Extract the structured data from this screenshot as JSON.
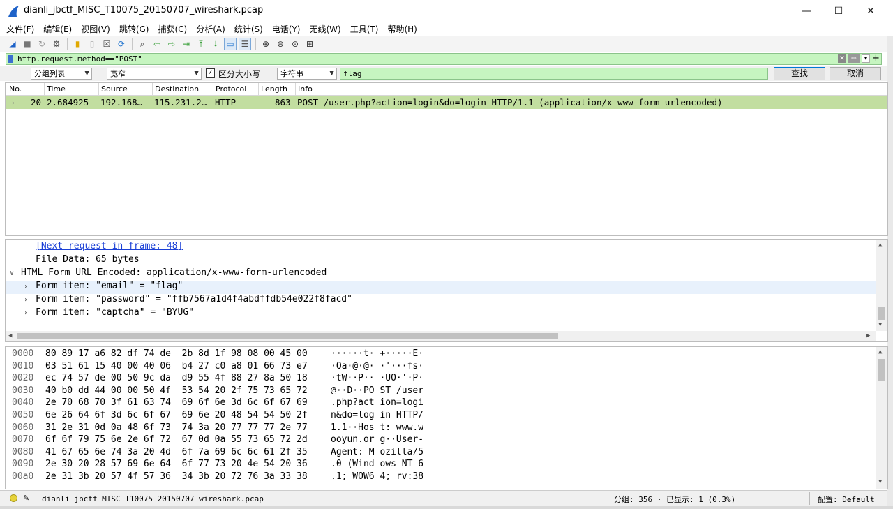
{
  "window": {
    "title": "dianli_jbctf_MISC_T10075_20150707_wireshark.pcap",
    "minimize": "—",
    "maximize": "☐",
    "close": "✕"
  },
  "menu": [
    "文件(F)",
    "编辑(E)",
    "视图(V)",
    "跳转(G)",
    "捕获(C)",
    "分析(A)",
    "统计(S)",
    "电话(Y)",
    "无线(W)",
    "工具(T)",
    "帮助(H)"
  ],
  "toolbar": {
    "icons": [
      "shark-fin-icon",
      "stop-icon",
      "restart-icon",
      "options-gear-icon",
      "open-file-icon",
      "file-icon",
      "close-file-icon",
      "reload-icon",
      "find-icon",
      "back-arrow-icon",
      "forward-arrow-icon",
      "go-to-packet-icon",
      "first-packet-icon",
      "last-packet-icon",
      "autoscroll-icon",
      "colorize-icon",
      "zoom-in-icon",
      "zoom-out-icon",
      "normal-size-icon",
      "resize-columns-icon"
    ],
    "glyphs": [
      "◢",
      "■",
      "↻",
      "⚙",
      "▮",
      "▯",
      "☒",
      "⟳",
      "⌕",
      "⇦",
      "⇨",
      "⇥",
      "⤒",
      "⤓",
      "▭",
      "☰",
      "⊕",
      "⊖",
      "⊙",
      "⊞"
    ]
  },
  "filter": {
    "value": "http.request.method==\"POST\"",
    "plus": "+",
    "clear": "✕",
    "apply": "⇨",
    "dropdown": "▾"
  },
  "find": {
    "search_in": "分组列表",
    "char_width": "宽窄",
    "case_sensitive_label": "区分大小写",
    "case_checked": "✓",
    "search_type": "字符串",
    "query": "flag",
    "find_button": "查找",
    "cancel_button": "取消"
  },
  "packet_list": {
    "columns": [
      "No.",
      "Time",
      "Source",
      "Destination",
      "Protocol",
      "Length",
      "Info"
    ],
    "rows": [
      {
        "marker": "→",
        "no": "20",
        "time": "2.684925",
        "source": "192.168…",
        "destination": "115.231.2…",
        "protocol": "HTTP",
        "length": "863",
        "info": "POST /user.php?action=login&do=login HTTP/1.1  (application/x-www-form-urlencoded)"
      }
    ]
  },
  "details": {
    "next_request": "[Next request in frame: 48]",
    "file_data": "File Data: 65 bytes",
    "form_header": "HTML Form URL Encoded: application/x-www-form-urlencoded",
    "items": [
      "Form item: \"email\" = \"flag\"",
      "Form item: \"password\" = \"ffb7567a1d4f4abdffdb54e022f8facd\"",
      "Form item: \"captcha\" = \"BYUG\""
    ]
  },
  "bytes": [
    {
      "offset": "0000",
      "hex": "80 89 17 a6 82 df 74 de  2b 8d 1f 98 08 00 45 00",
      "ascii": "······t· +·····E·"
    },
    {
      "offset": "0010",
      "hex": "03 51 61 15 40 00 40 06  b4 27 c0 a8 01 66 73 e7",
      "ascii": "·Qa·@·@· ·'···fs·"
    },
    {
      "offset": "0020",
      "hex": "ec 74 57 de 00 50 9c da  d9 55 4f 88 27 8a 50 18",
      "ascii": "·tW··P·· ·UO·'·P·"
    },
    {
      "offset": "0030",
      "hex": "40 b0 dd 44 00 00 50 4f  53 54 20 2f 75 73 65 72",
      "ascii": "@··D··PO ST /user"
    },
    {
      "offset": "0040",
      "hex": "2e 70 68 70 3f 61 63 74  69 6f 6e 3d 6c 6f 67 69",
      "ascii": ".php?act ion=logi"
    },
    {
      "offset": "0050",
      "hex": "6e 26 64 6f 3d 6c 6f 67  69 6e 20 48 54 54 50 2f",
      "ascii": "n&do=log in HTTP/"
    },
    {
      "offset": "0060",
      "hex": "31 2e 31 0d 0a 48 6f 73  74 3a 20 77 77 77 2e 77",
      "ascii": "1.1··Hos t: www.w"
    },
    {
      "offset": "0070",
      "hex": "6f 6f 79 75 6e 2e 6f 72  67 0d 0a 55 73 65 72 2d",
      "ascii": "ooyun.or g··User-"
    },
    {
      "offset": "0080",
      "hex": "41 67 65 6e 74 3a 20 4d  6f 7a 69 6c 6c 61 2f 35",
      "ascii": "Agent: M ozilla/5"
    },
    {
      "offset": "0090",
      "hex": "2e 30 20 28 57 69 6e 64  6f 77 73 20 4e 54 20 36",
      "ascii": ".0 (Wind ows NT 6"
    },
    {
      "offset": "00a0",
      "hex": "2e 31 3b 20 57 4f 57 36  34 3b 20 72 76 3a 33 38",
      "ascii": ".1; WOW6 4; rv:38"
    }
  ],
  "status": {
    "file": "dianli_jbctf_MISC_T10075_20150707_wireshark.pcap",
    "stats": "分组: 356 · 已显示: 1 (0.3%)",
    "profile": "配置: Default"
  }
}
